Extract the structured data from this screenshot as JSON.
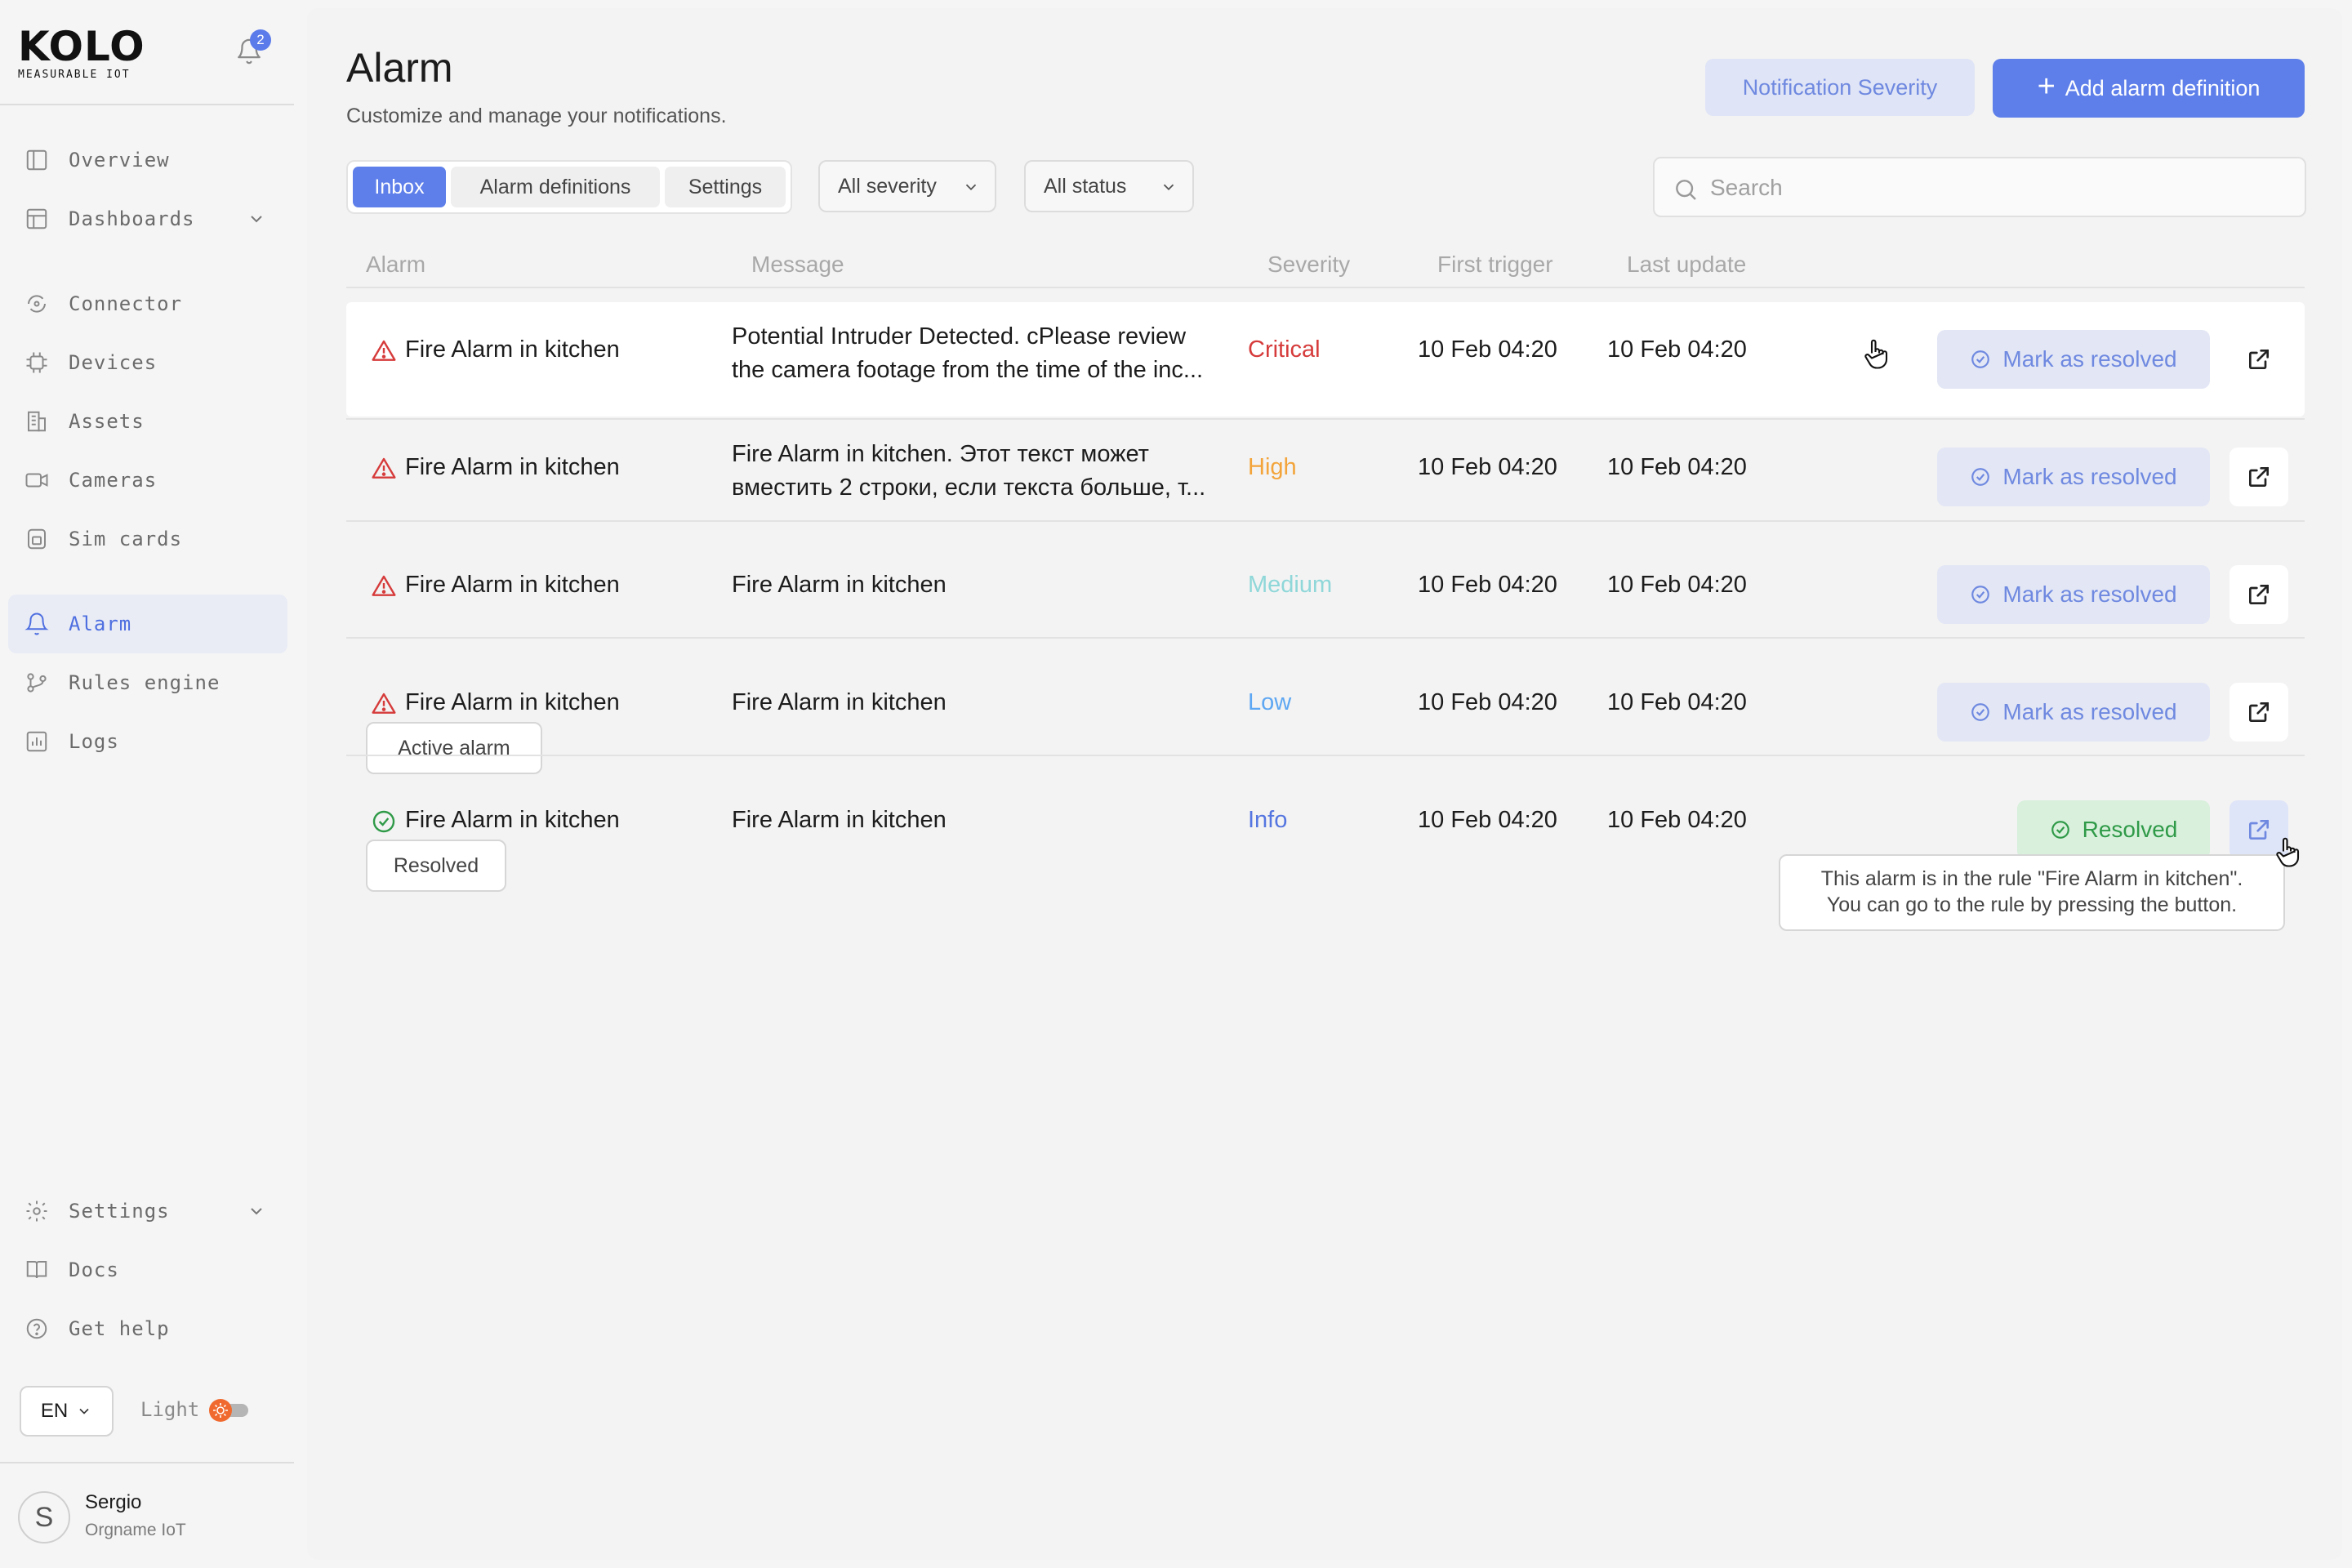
{
  "sidebar": {
    "logo": "KOLO",
    "logo_subtitle": "MEASURABLE IOT",
    "notifications_count": "2",
    "nav": [
      {
        "label": "Overview",
        "icon": "overview-icon"
      },
      {
        "label": "Dashboards",
        "icon": "dashboard-icon",
        "expandable": true
      },
      {
        "label": "Connector",
        "icon": "connector-icon"
      },
      {
        "label": "Devices",
        "icon": "chip-icon"
      },
      {
        "label": "Assets",
        "icon": "building-icon"
      },
      {
        "label": "Cameras",
        "icon": "camera-icon"
      },
      {
        "label": "Sim cards",
        "icon": "sim-card-icon"
      },
      {
        "label": "Alarm",
        "icon": "bell-icon",
        "active": true
      },
      {
        "label": "Rules engine",
        "icon": "branch-icon"
      },
      {
        "label": "Logs",
        "icon": "chart-icon"
      }
    ],
    "bottom_nav": [
      {
        "label": "Settings",
        "icon": "gear-icon",
        "expandable": true
      },
      {
        "label": "Docs",
        "icon": "book-icon"
      },
      {
        "label": "Get help",
        "icon": "help-icon"
      }
    ],
    "language": "EN",
    "theme_label": "Light",
    "user": {
      "initial": "S",
      "name": "Sergio",
      "org": "Orgname IoT"
    }
  },
  "header": {
    "title": "Alarm",
    "subtitle": "Customize and manage your notifications.",
    "severity_button": "Notification Severity",
    "add_button": "Add alarm definition"
  },
  "tabs": [
    {
      "label": "Inbox",
      "active": true
    },
    {
      "label": "Alarm definitions"
    },
    {
      "label": "Settings"
    }
  ],
  "filters": {
    "severity": "All severity",
    "status": "All status",
    "search_placeholder": "Search"
  },
  "table": {
    "columns": [
      "Alarm",
      "Message",
      "Severity",
      "First trigger",
      "Last update"
    ],
    "rows": [
      {
        "alarm": "Fire Alarm in kitchen",
        "message_lines": [
          "Potential Intruder Detected. cPlease review",
          "the camera footage from the time of the inc..."
        ],
        "severity": "Critical",
        "first_trigger": "10 Feb 04:20",
        "last_update": "10 Feb 04:20",
        "action": "Mark as resolved",
        "status": "active"
      },
      {
        "alarm": "Fire Alarm in kitchen",
        "message_lines": [
          "Fire Alarm in kitchen. Этот текст может",
          "вместить 2 строки, если текста больше, т..."
        ],
        "severity": "High",
        "first_trigger": "10 Feb 04:20",
        "last_update": "10 Feb 04:20",
        "action": "Mark as resolved",
        "status": "active"
      },
      {
        "alarm": "Fire Alarm in kitchen",
        "message_lines": [
          "Fire Alarm in kitchen"
        ],
        "severity": "Medium",
        "first_trigger": "10 Feb 04:20",
        "last_update": "10 Feb 04:20",
        "action": "Mark as resolved",
        "status": "active"
      },
      {
        "alarm": "Fire Alarm in kitchen",
        "message_lines": [
          "Fire Alarm in kitchen"
        ],
        "severity": "Low",
        "first_trigger": "10 Feb 04:20",
        "last_update": "10 Feb 04:20",
        "action": "Mark as resolved",
        "status": "active",
        "hover_label": "Active alarm"
      },
      {
        "alarm": "Fire Alarm in kitchen",
        "message_lines": [
          "Fire Alarm in kitchen"
        ],
        "severity": "Info",
        "first_trigger": "10 Feb 04:20",
        "last_update": "10 Feb 04:20",
        "action": "Resolved",
        "status": "resolved",
        "hover_label": "Resolved"
      }
    ]
  },
  "tooltip": {
    "line1": "This alarm is in the rule \"Fire Alarm in kitchen\".",
    "line2": "You can go to the rule by pressing the button."
  },
  "colors": {
    "accent": "#5e7fea",
    "critical": "#d63b3b",
    "high": "#f3a43a",
    "medium": "#8fd7d9",
    "low": "#5ea7f2",
    "info": "#5576e0",
    "resolved": "#2f9a48"
  }
}
